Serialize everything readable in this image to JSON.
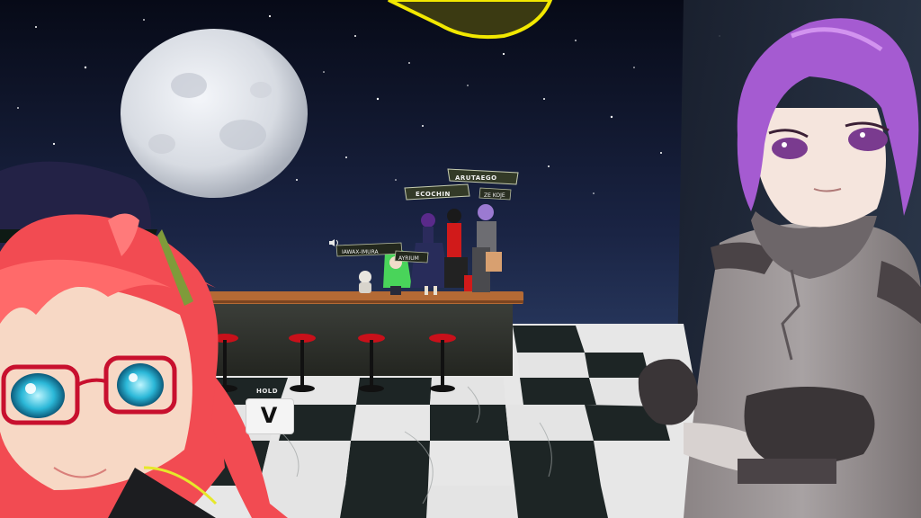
{
  "nameplates": [
    {
      "id": "arutaego",
      "text": "ARUTAEGO"
    },
    {
      "id": "ecochin",
      "text": "ECOCHIN"
    },
    {
      "id": "small-right",
      "text": "ZE KOJE"
    },
    {
      "id": "iawax",
      "text": "IAWAX-IMURA"
    },
    {
      "id": "ayrium",
      "text": "AYRIUM"
    }
  ],
  "hud": {
    "hint_label": "HOLD",
    "hint_key": "V"
  },
  "icons": [
    "voice-icon"
  ],
  "colors": {
    "sky_top": "#070a17",
    "sky_horizon": "#3d5685",
    "moon": "#e3e6ec",
    "bar_counter": "#b46a35",
    "stool_seat": "#c9101a",
    "floor_light": "#e7e7e7",
    "floor_dark": "#1d2525",
    "highlight_outline": "#f2e800",
    "left_avatar_hair": "#f24b52",
    "right_avatar_hair": "#a55bd1"
  }
}
